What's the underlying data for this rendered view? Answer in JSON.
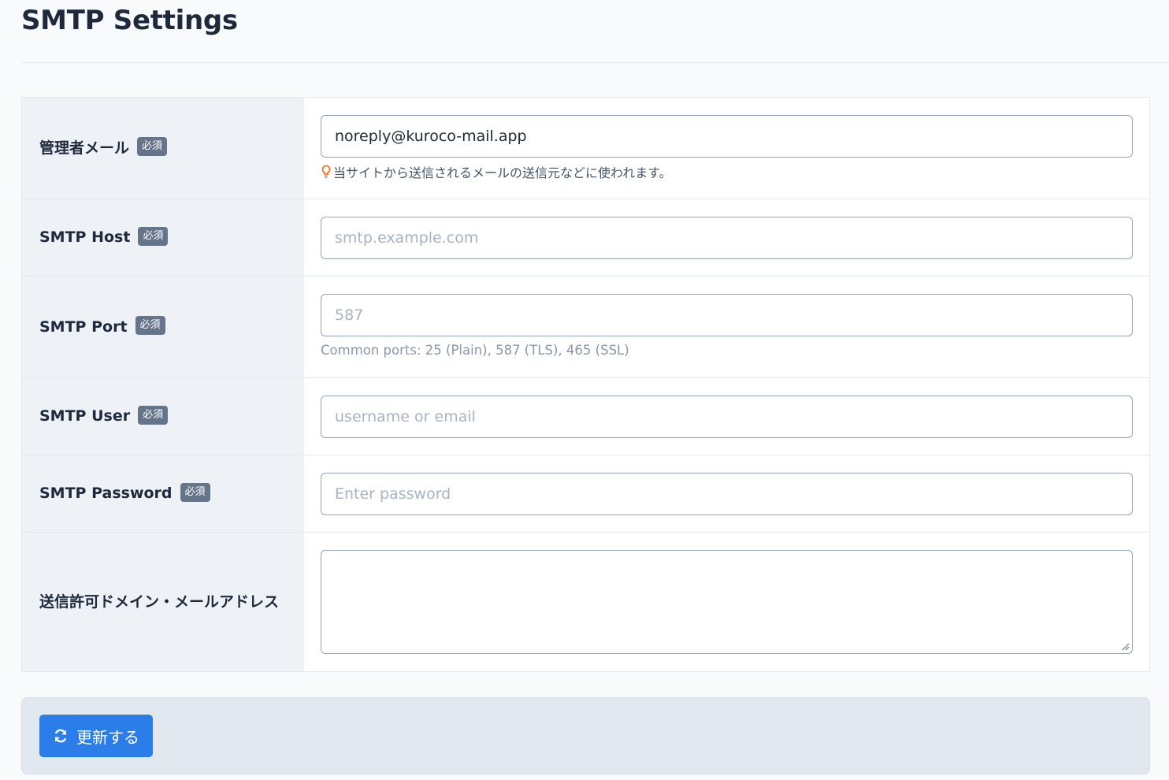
{
  "page": {
    "title": "SMTP Settings"
  },
  "form": {
    "required_badge": "必須",
    "admin_email": {
      "label": "管理者メール",
      "value": "noreply@kuroco-mail.app",
      "help": "当サイトから送信されるメールの送信元などに使われます。"
    },
    "smtp_host": {
      "label": "SMTP Host",
      "placeholder": "smtp.example.com"
    },
    "smtp_port": {
      "label": "SMTP Port",
      "placeholder": "587",
      "help": "Common ports: 25 (Plain), 587 (TLS), 465 (SSL)"
    },
    "smtp_user": {
      "label": "SMTP User",
      "placeholder": "username or email"
    },
    "smtp_password": {
      "label": "SMTP Password",
      "placeholder": "Enter password"
    },
    "allowed_domains": {
      "label": "送信許可ドメイン・メールアドレス",
      "value": ""
    }
  },
  "footer": {
    "update_label": "更新する"
  },
  "icons": {
    "help": "lightbulb-icon",
    "update": "refresh-icon"
  },
  "colors": {
    "primary": "#2b7de9",
    "badge": "#64748b",
    "bulb": "#f97316"
  }
}
